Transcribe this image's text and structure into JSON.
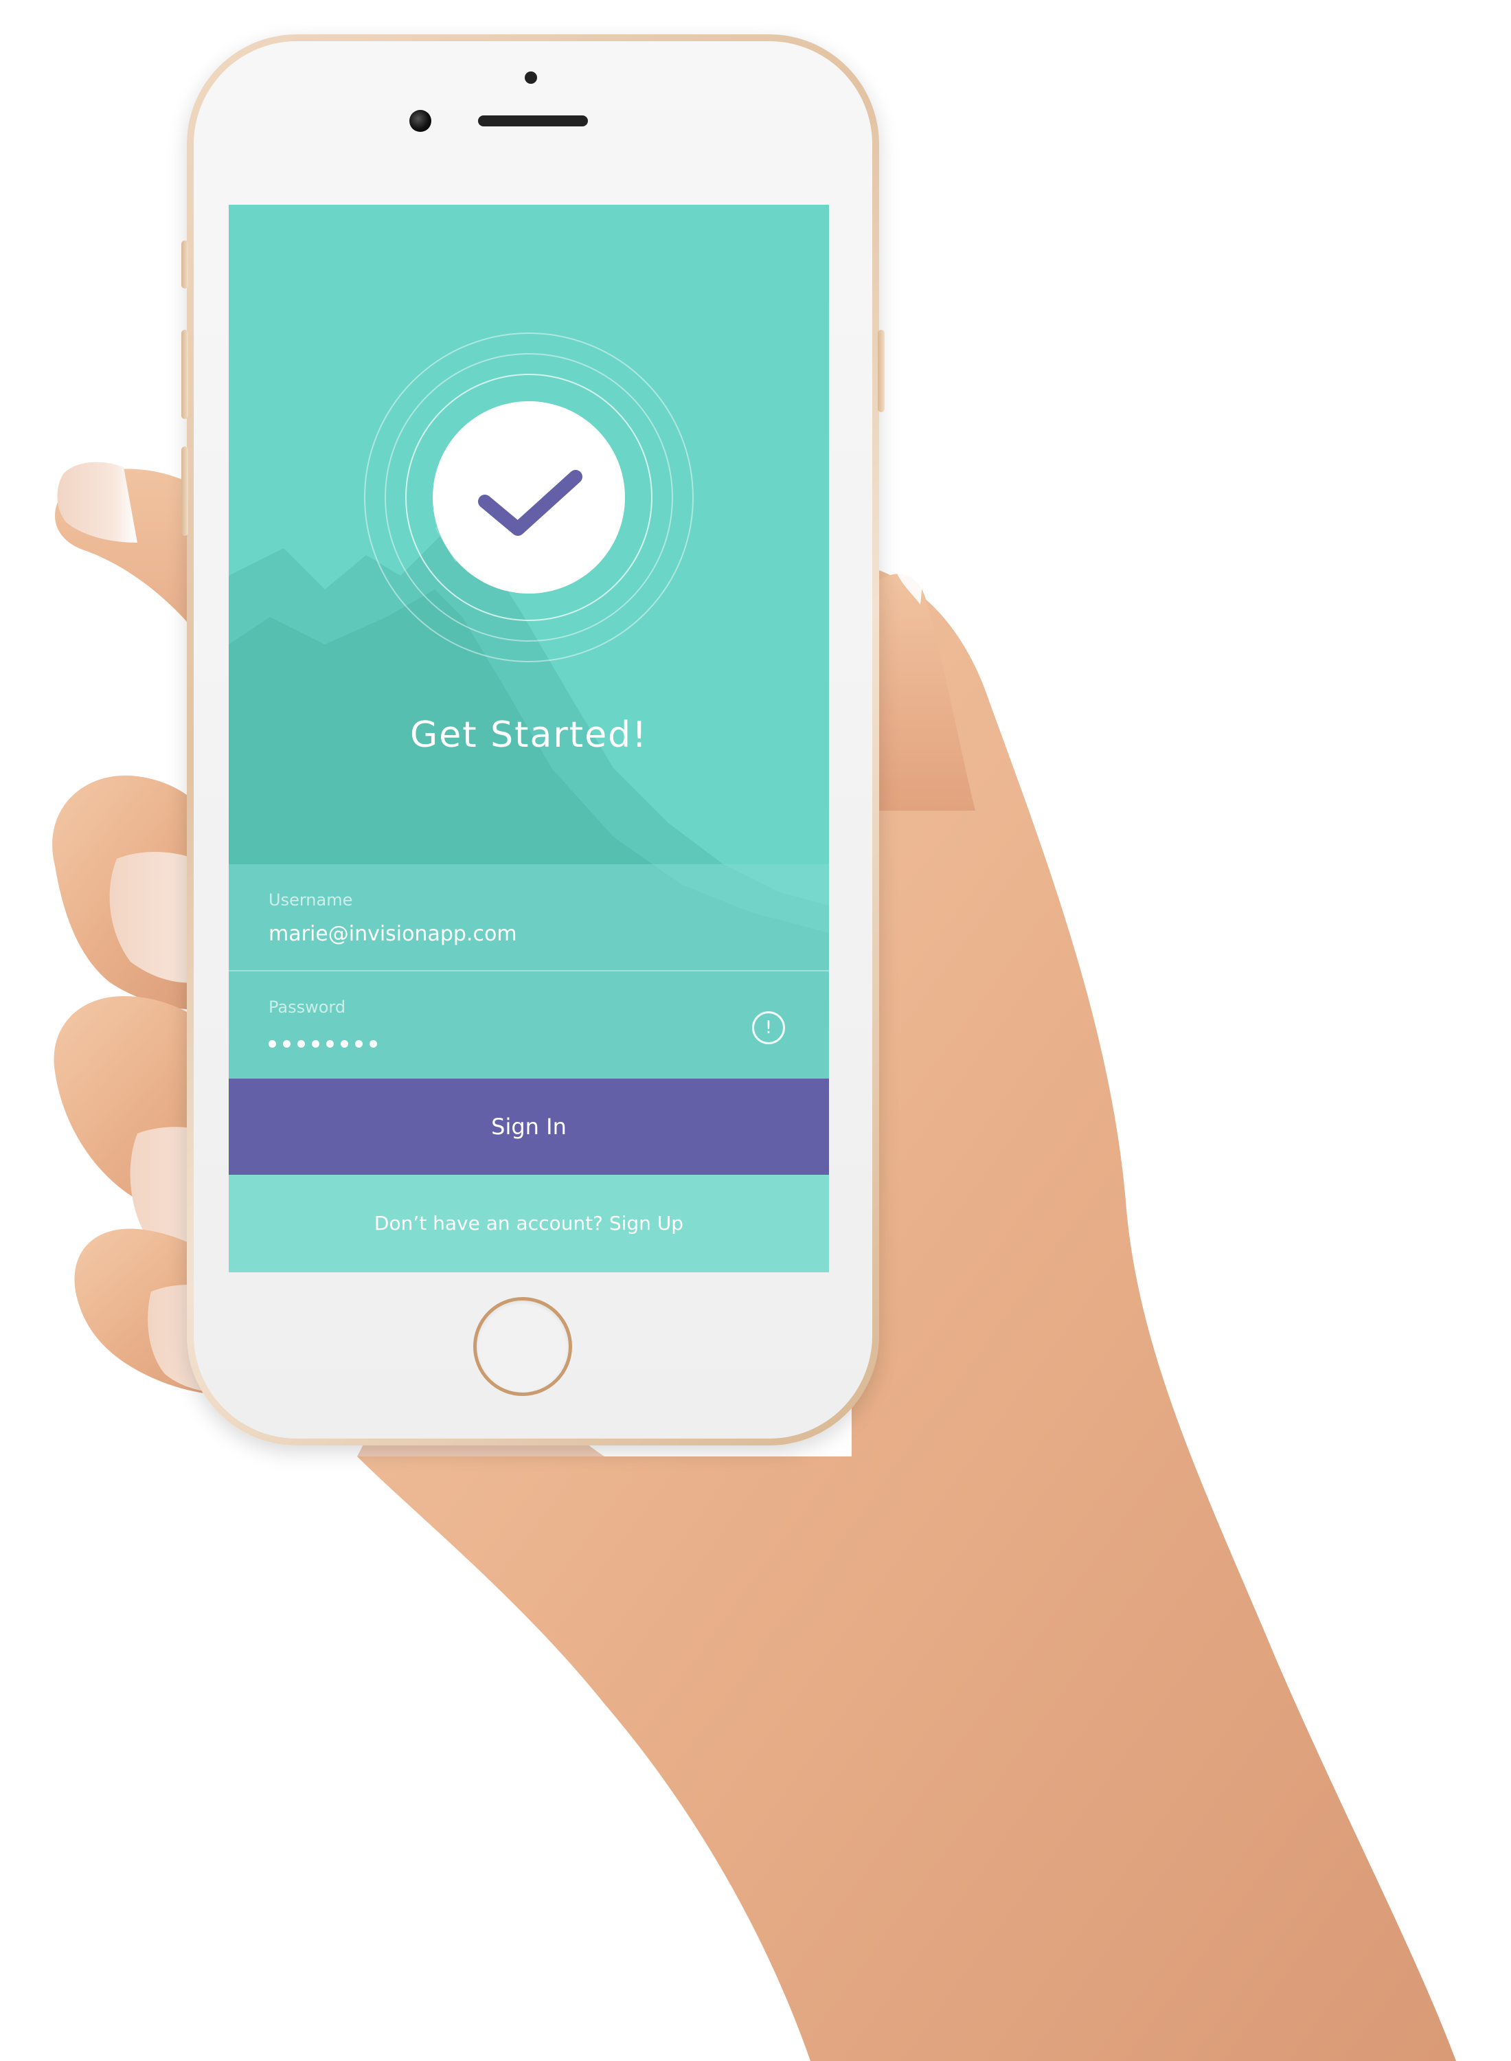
{
  "app": {
    "headline": "Get Started!",
    "icon": "checkmark-icon"
  },
  "form": {
    "username": {
      "label": "Username",
      "value": "marie@invisionapp.com"
    },
    "password": {
      "label": "Password",
      "masked_length": 8,
      "alert_glyph": "!",
      "alert_icon": "alert-circle-icon"
    }
  },
  "actions": {
    "sign_in_label": "Sign In",
    "signup_prompt": "Don’t have an account?",
    "signup_link": "Sign Up"
  },
  "colors": {
    "screen_bg": "#6bd5c7",
    "accent": "#6460a8",
    "check": "#6460a8",
    "text": "#ffffff",
    "phone_frame": "#e2c3a3"
  }
}
